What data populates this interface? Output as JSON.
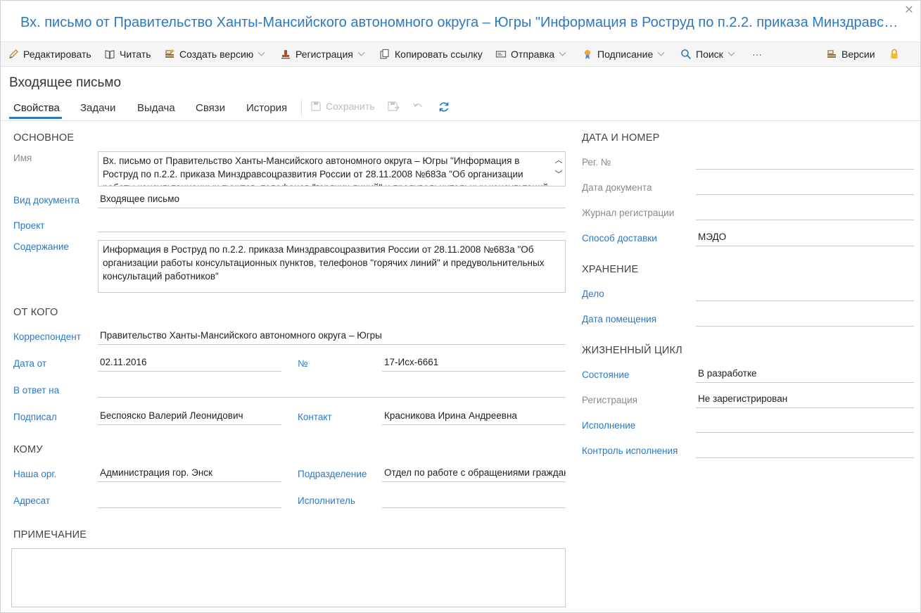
{
  "window": {
    "title": "Вх. письмо от Правительство Ханты-Мансийского автономного округа – Югры \"Информация в Роструд по п.2.2. приказа Минздравсоцразвития России от 28.11.2008 №683а \"Об организации работы консультационных пунктов, телефонов \"горячих линий\" и предувольнительных консультаций работников\"",
    "close": "✕"
  },
  "toolbar": {
    "edit": "Редактировать",
    "read": "Читать",
    "create_version": "Создать версию",
    "registration": "Регистрация",
    "copy_link": "Копировать ссылку",
    "send": "Отправка",
    "sign": "Подписание",
    "search": "Поиск",
    "more": "···",
    "versions": "Версии"
  },
  "doc_type": "Входящее письмо",
  "tabs": {
    "properties": "Свойства",
    "tasks": "Задачи",
    "issue": "Выдача",
    "links": "Связи",
    "history": "История",
    "save": "Сохранить"
  },
  "main": {
    "title": "ОСНОВНОЕ",
    "name_label": "Имя",
    "name_value": "Вх. письмо от Правительство Ханты-Мансийского автономного округа – Югры \"Информация в Роструд по п.2.2. приказа Минздравсоцразвития России от 28.11.2008 №683а \"Об организации работы консультационных пунктов, телефонов \"горячих линий\" и предувольнительных консультаций работников\"",
    "doc_kind_label": "Вид документа",
    "doc_kind_value": "Входящее письмо",
    "project_label": "Проект",
    "project_value": "",
    "content_label": "Содержание",
    "content_value": "Информация в Роструд по п.2.2. приказа Минздравсоцразвития России от 28.11.2008 №683а \"Об организации работы консультационных пунктов, телефонов \"горячих линий\" и предувольнительных консультаций работников\""
  },
  "from": {
    "title": "ОТ КОГО",
    "correspondent_label": "Корреспондент",
    "correspondent_value": "Правительство Ханты-Мансийского автономного округа – Югры",
    "date_label": "Дата от",
    "date_value": "02.11.2016",
    "number_label": "№",
    "number_value": "17-Исх-6661",
    "reply_label": "В ответ на",
    "reply_value": "",
    "signed_label": "Подписал",
    "signed_value": "Беспояско Валерий Леонидович",
    "contact_label": "Контакт",
    "contact_value": "Красникова Ирина Андреевна"
  },
  "to": {
    "title": "КОМУ",
    "org_label": "Наша орг.",
    "org_value": "Администрация гор. Энск",
    "dept_label": "Подразделение",
    "dept_value": "Отдел по работе с обращениями граждан",
    "addressee_label": "Адресат",
    "addressee_value": "",
    "executor_label": "Исполнитель",
    "executor_value": ""
  },
  "note": {
    "title": "ПРИМЕЧАНИЕ",
    "value": ""
  },
  "date_number": {
    "title": "ДАТА И НОМЕР",
    "reg_no_label": "Рег. №",
    "reg_no_value": "",
    "doc_date_label": "Дата документа",
    "doc_date_value": "",
    "journal_label": "Журнал регистрации",
    "journal_value": "",
    "delivery_label": "Способ доставки",
    "delivery_value": "МЭДО"
  },
  "storage": {
    "title": "ХРАНЕНИЕ",
    "case_label": "Дело",
    "case_value": "",
    "placed_label": "Дата помещения",
    "placed_value": ""
  },
  "lifecycle": {
    "title": "ЖИЗНЕННЫЙ ЦИКЛ",
    "state_label": "Состояние",
    "state_value": "В разработке",
    "reg_label": "Регистрация",
    "reg_value": "Не зарегистрирован",
    "exec_label": "Исполнение",
    "exec_value": "",
    "control_label": "Контроль исполнения",
    "control_value": ""
  },
  "colors": {
    "accent": "#2b79c2",
    "toolbar_bg": "#f5f5f5"
  }
}
